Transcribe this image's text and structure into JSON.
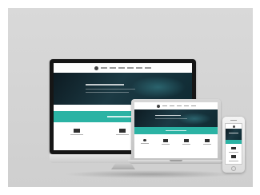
{
  "scene": {
    "background_color": "#d6d6d6",
    "accent_color": "#2bb3a4",
    "hero_color": "#142a33"
  },
  "devices": [
    "desktop-monitor",
    "laptop",
    "smartphone"
  ],
  "watermark": ""
}
